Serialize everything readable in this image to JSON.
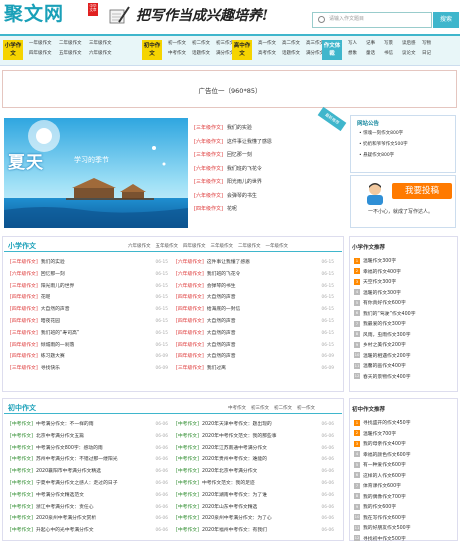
{
  "header": {
    "logo": "聚文网",
    "logo_badge": "中华文章",
    "slogan": "把写作当成兴趣培养!",
    "search_placeholder": "请输入作文题目",
    "search_button": "搜索"
  },
  "nav": {
    "groups": [
      {
        "cat": "小学作文",
        "color": "#f5d400",
        "rows": [
          [
            "一年级作文",
            "二年级作文",
            "三年级作文"
          ],
          [
            "四年级作文",
            "五年级作文",
            "六年级作文"
          ]
        ]
      },
      {
        "cat": "初中作文",
        "color": "#f5d400",
        "rows": [
          [
            "初一作文",
            "初二作文",
            "初三作文"
          ],
          [
            "中考作文",
            "话题作文",
            "满分作文"
          ]
        ]
      },
      {
        "cat": "高中作文",
        "color": "#f5d400",
        "rows": [
          [
            "高一作文",
            "高二作文",
            "高三作文"
          ],
          [
            "高考作文",
            "话题作文",
            "满分作文"
          ]
        ]
      },
      {
        "cat": "作文体裁",
        "color": "#3fb6cc",
        "rows": [
          [
            "写人",
            "记事",
            "写景",
            "读后感",
            "写物"
          ],
          [
            "想象",
            "童话",
            "书信",
            "议论文",
            "日记"
          ]
        ]
      }
    ]
  },
  "ad": {
    "text": "广告位一（960*85）"
  },
  "banner": {
    "title": "夏天",
    "subtitle": "学习的季节"
  },
  "lead_list": [
    {
      "tag": "[三年级作文]",
      "title": "我们的实验"
    },
    {
      "tag": "[六年级作文]",
      "title": "这件事让我懂了感恩"
    },
    {
      "tag": "[三年级作文]",
      "title": "回忆那一刻"
    },
    {
      "tag": "[六年级作文]",
      "title": "我们班的飞花令"
    },
    {
      "tag": "[三年级作文]",
      "title": "阳光雨儿的世界"
    },
    {
      "tag": "[六年级作文]",
      "title": "会弹琴的书生"
    },
    {
      "tag": "[四年级作文]",
      "title": "花呢"
    }
  ],
  "ribbon": "最新推荐",
  "notice": {
    "title": "网站公告",
    "items": [
      "惊魂一刻作文800字",
      "奶奶和爷爷作文500字",
      "悬疑作文800字"
    ]
  },
  "contribute": {
    "button": "我要投稿",
    "text": "一不小心，就成了写作达人。"
  },
  "primary": {
    "title": "小学作文",
    "tabs": [
      "六年级作文",
      "五年级作文",
      "四年级作文",
      "三年级作文",
      "二年级作文",
      "一年级作文"
    ],
    "left": [
      {
        "tag": "[三年级作文]",
        "title": "我们的实验",
        "date": "06-15"
      },
      {
        "tag": "[六年级作文]",
        "title": "回忆那一刻",
        "date": "06-15"
      },
      {
        "tag": "[三年级作文]",
        "title": "阳光雨儿的世界",
        "date": "06-15"
      },
      {
        "tag": "[四年级作文]",
        "title": "花呢",
        "date": "06-15"
      },
      {
        "tag": "[四年级作文]",
        "title": "大自然的声音",
        "date": "06-15"
      },
      {
        "tag": "[四年级作文]",
        "title": "暗夜花园",
        "date": "06-15"
      },
      {
        "tag": "[三年级作文]",
        "title": "我们班的“寿司高”",
        "date": "06-15"
      },
      {
        "tag": "[四年级作文]",
        "title": "倾城雨的一刹落",
        "date": "06-15"
      },
      {
        "tag": "[四年级作文]",
        "title": "练习题大赛",
        "date": "06-09"
      },
      {
        "tag": "[三年级作文]",
        "title": "寻找快乐",
        "date": "06-09"
      }
    ],
    "right": [
      {
        "tag": "[六年级作文]",
        "title": "这件事让我懂了感恩",
        "date": "06-15"
      },
      {
        "tag": "[六年级作文]",
        "title": "我们班的飞花令",
        "date": "06-15"
      },
      {
        "tag": "[六年级作文]",
        "title": "会弹琴的书生",
        "date": "06-15"
      },
      {
        "tag": "[四年级作文]",
        "title": "大自然的声音",
        "date": "06-15"
      },
      {
        "tag": "[四年级作文]",
        "title": "给海底的一封信",
        "date": "06-15"
      },
      {
        "tag": "[四年级作文]",
        "title": "大自然的声音",
        "date": "06-15"
      },
      {
        "tag": "[四年级作文]",
        "title": "大自然的声音",
        "date": "06-15"
      },
      {
        "tag": "[四年级作文]",
        "title": "大自然的声音",
        "date": "06-15"
      },
      {
        "tag": "[四年级作文]",
        "title": "大自然的声音",
        "date": "06-09"
      },
      {
        "tag": "[三年级作文]",
        "title": "我们过离",
        "date": "06-09"
      }
    ]
  },
  "primary_rank": {
    "title": "小学作文推荐",
    "items": [
      "温暖作文300字",
      "幸福的作文400字",
      "天空作文300字",
      "温暖的作文300字",
      "有你真好作文600字",
      "我们的“驾驶”作文400字",
      "我最爱的作文300字",
      "风雨，虫雨作文300字",
      "乡村之美作文200字",
      "温暖的相遇作文200字",
      "温馨的画作文400字",
      "春天的景物作文400字"
    ]
  },
  "junior": {
    "title": "初中作文",
    "tabs": [
      "中考作文",
      "初三作文",
      "初二作文",
      "初一作文"
    ],
    "left": [
      {
        "tag": "[中考作文]",
        "title": "中考满分作文：不一样的雨",
        "date": "06-06"
      },
      {
        "tag": "[中考作文]",
        "title": "北京中考满分作文五篇",
        "date": "06-06"
      },
      {
        "tag": "[中考作文]",
        "title": "中考满分作文800字：感动的雨",
        "date": "06-06"
      },
      {
        "tag": "[中考作文]",
        "title": "苏州中考满分作文：不错过那一缕阳光",
        "date": "06-06"
      },
      {
        "tag": "[中考作文]",
        "title": "2020襄阳市中考满分作文精选",
        "date": "06-06"
      },
      {
        "tag": "[中考作文]",
        "title": "宁夏中考满分作文之感人：走过的日子",
        "date": "06-06"
      },
      {
        "tag": "[中考作文]",
        "title": "中考满分作文精选范文",
        "date": "06-06"
      },
      {
        "tag": "[中考作文]",
        "title": "浙江中考满分作文：责任心",
        "date": "06-06"
      },
      {
        "tag": "[中考作文]",
        "title": "2020泉州中考满分作文赏析",
        "date": "06-06"
      },
      {
        "tag": "[中考作文]",
        "title": "升起心中的光中考满分作文",
        "date": "06-06"
      }
    ],
    "right": [
      {
        "tag": "[中考作文]",
        "title": "2020年天津中考作文：题出现的",
        "date": "06-06"
      },
      {
        "tag": "[中考作文]",
        "title": "2020年中考作文范文：我的那些事",
        "date": "06-06"
      },
      {
        "tag": "[中考作文]",
        "title": "2020年江苏南通中考满分作文",
        "date": "06-06"
      },
      {
        "tag": "[中考作文]",
        "title": "2020年贵州中考作文：难能的",
        "date": "06-06"
      },
      {
        "tag": "[中考作文]",
        "title": "2020年北京中考满分作文",
        "date": "06-06"
      },
      {
        "tag": "[中考作文]",
        "title": "中考作文范文：我的足迹",
        "date": "06-06"
      },
      {
        "tag": "[中考作文]",
        "title": "2020年湖南中考作文：为了谁",
        "date": "06-06"
      },
      {
        "tag": "[中考作文]",
        "title": "2020年山东中考作文精选",
        "date": "06-06"
      },
      {
        "tag": "[中考作文]",
        "title": "2020泉州中考满分作文：为了心",
        "date": "06-06"
      },
      {
        "tag": "[中考作文]",
        "title": "2020年福州中考作文：有我们",
        "date": "06-06"
      }
    ]
  },
  "junior_rank": {
    "title": "初中作文推荐",
    "items": [
      "寻找盛开的作文450字",
      "温暖作文700字",
      "我的母亲作文400字",
      "幸福的颜色作文600字",
      "有一种爱作文600字",
      "这样的人作文600字",
      "体育课作文600字",
      "我的偶像作文700字",
      "我的作文600字",
      "我在写作作文600字",
      "我的好朋友作文500字",
      "寻找初中作文500字"
    ]
  }
}
